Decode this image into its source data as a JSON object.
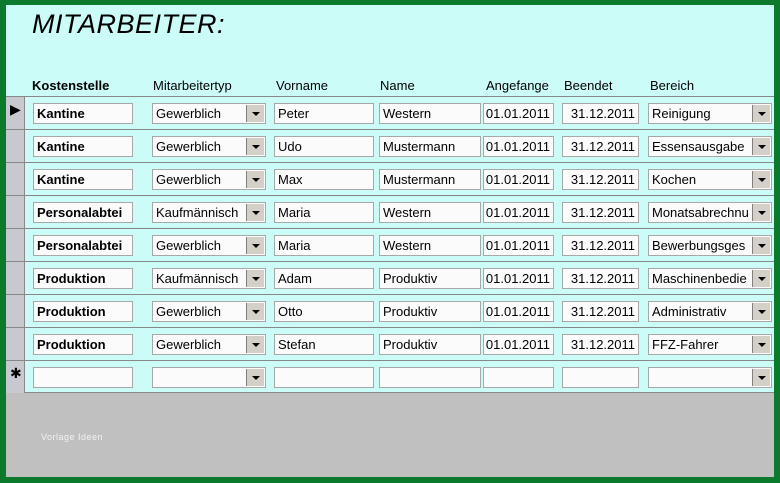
{
  "window": {
    "title": "MITARBEITER:"
  },
  "columns": {
    "kostenstelle": "Kostenstelle",
    "mitarbeitertyp": "Mitarbeitertyp",
    "vorname": "Vorname",
    "name": "Name",
    "angefangen": "Angefange",
    "beendet": "Beendet",
    "bereich": "Bereich"
  },
  "records": [
    {
      "kostenstelle": "Kantine",
      "typ": "Gewerblich",
      "vorname": "Peter",
      "name": "Western",
      "start": "01.01.2011",
      "end": "31.12.2011",
      "bereich": "Reinigung"
    },
    {
      "kostenstelle": "Kantine",
      "typ": "Gewerblich",
      "vorname": "Udo",
      "name": "Mustermann",
      "start": "01.01.2011",
      "end": "31.12.2011",
      "bereich": "Essensausgabe"
    },
    {
      "kostenstelle": "Kantine",
      "typ": "Gewerblich",
      "vorname": "Max",
      "name": "Mustermann",
      "start": "01.01.2011",
      "end": "31.12.2011",
      "bereich": "Kochen"
    },
    {
      "kostenstelle": "Personalabtei",
      "typ": "Kaufmännisch",
      "vorname": "Maria",
      "name": "Western",
      "start": "01.01.2011",
      "end": "31.12.2011",
      "bereich": "Monatsabrechnu"
    },
    {
      "kostenstelle": "Personalabtei",
      "typ": "Gewerblich",
      "vorname": "Maria",
      "name": "Western",
      "start": "01.01.2011",
      "end": "31.12.2011",
      "bereich": "Bewerbungsges"
    },
    {
      "kostenstelle": "Produktion",
      "typ": "Kaufmännisch",
      "vorname": "Adam",
      "name": "Produktiv",
      "start": "01.01.2011",
      "end": "31.12.2011",
      "bereich": "Maschinenbedie"
    },
    {
      "kostenstelle": "Produktion",
      "typ": "Gewerblich",
      "vorname": "Otto",
      "name": "Produktiv",
      "start": "01.01.2011",
      "end": "31.12.2011",
      "bereich": "Administrativ"
    },
    {
      "kostenstelle": "Produktion",
      "typ": "Gewerblich",
      "vorname": "Stefan",
      "name": "Produktiv",
      "start": "01.01.2011",
      "end": "31.12.2011",
      "bereich": "FFZ-Fahrer"
    },
    {
      "kostenstelle": "",
      "typ": "",
      "vorname": "",
      "name": "",
      "start": "",
      "end": "",
      "bereich": ""
    }
  ],
  "selectors": {
    "current": "▶",
    "new": "✱"
  },
  "footer": {
    "text": "Vorlage Ideen"
  },
  "colors": {
    "header_bg": "#ccfcf8",
    "frame_bg": "#0c7a2c",
    "body_bg": "#c0c0c0"
  },
  "icons": {
    "dropdown": "chevron-down-icon",
    "current_record": "record-pointer-icon",
    "new_record": "new-record-icon"
  }
}
